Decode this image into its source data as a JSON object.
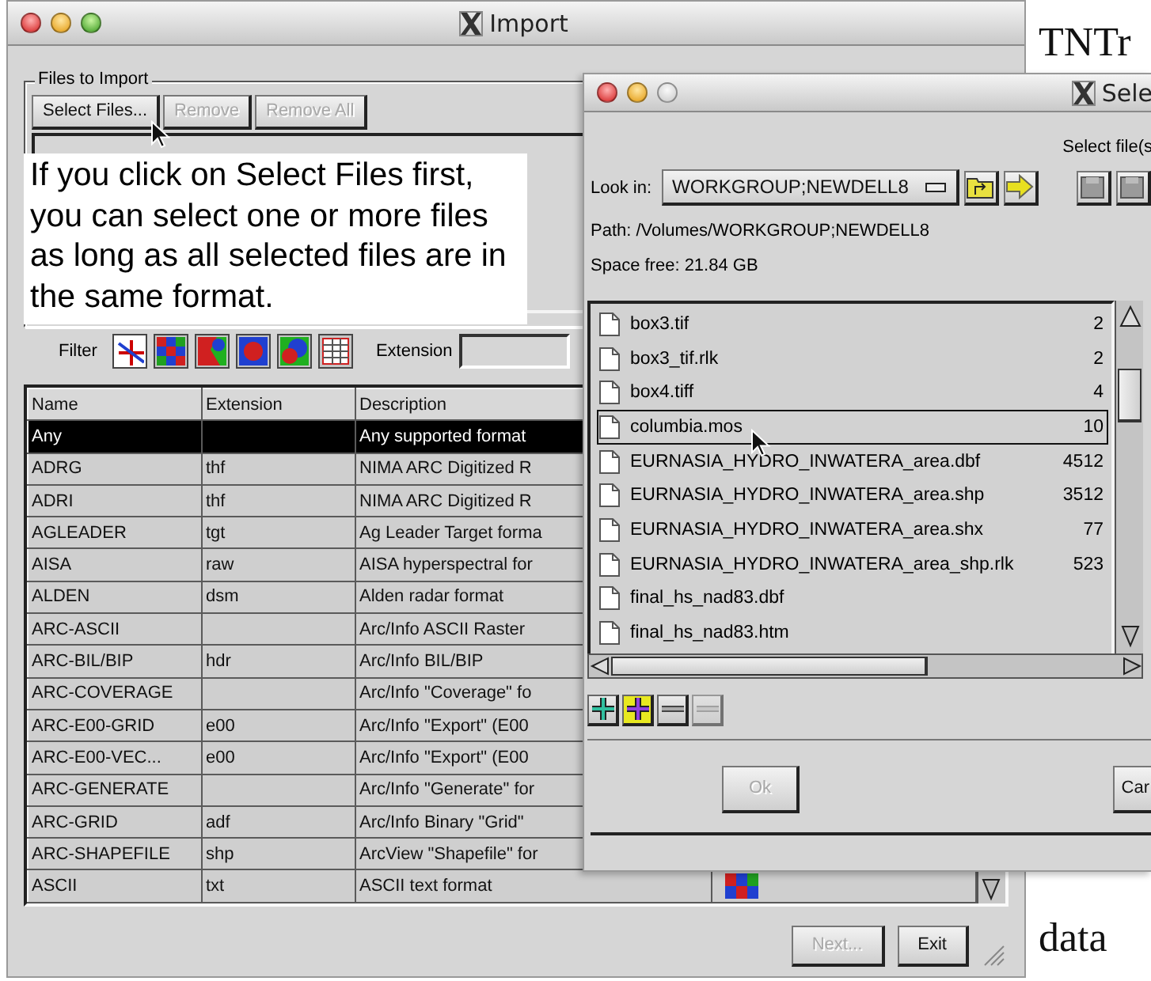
{
  "page_text": {
    "top": "TNTr",
    "bottom": "data"
  },
  "import_window": {
    "title": "Import",
    "group_label": "Files to Import",
    "buttons": [
      {
        "label": "Select Files...",
        "disabled": false
      },
      {
        "label": "Remove",
        "disabled": true
      },
      {
        "label": "Remove All",
        "disabled": true
      }
    ],
    "callout": "If you click on Select Files first, you can select one or more files as long as all selected files are in the same format.",
    "filter_label": "Filter",
    "filters": [
      {
        "kind": "axes",
        "selected": true
      },
      {
        "kind": "checker",
        "selected": false
      },
      {
        "kind": "blobs",
        "selected": false
      },
      {
        "kind": "dot",
        "selected": false
      },
      {
        "kind": "circles",
        "selected": false
      },
      {
        "kind": "table",
        "selected": false
      }
    ],
    "extension_label": "Extension",
    "table": {
      "columns": [
        "Name",
        "Extension",
        "Description"
      ],
      "rows": [
        {
          "name": "Any",
          "description": "Any supported format",
          "selected": true,
          "preview": false
        },
        {
          "name": "ADRG",
          "extension": "thf",
          "description": "NIMA ARC Digitized R",
          "selected": false,
          "preview": false
        },
        {
          "name": "ADRI",
          "extension": "thf",
          "description": "NIMA ARC Digitized R",
          "selected": false,
          "preview": false
        },
        {
          "name": "AGLEADER",
          "extension": "tgt",
          "description": "Ag Leader Target forma",
          "selected": false,
          "preview": false
        },
        {
          "name": "AISA",
          "extension": "raw",
          "description": "AISA hyperspectral for",
          "selected": false,
          "preview": false
        },
        {
          "name": "ALDEN",
          "extension": "dsm",
          "description": "Alden radar format",
          "selected": false,
          "preview": false
        },
        {
          "name": "ARC-ASCII",
          "description": "Arc/Info ASCII Raster",
          "selected": false,
          "preview": false
        },
        {
          "name": "ARC-BIL/BIP",
          "extension": "hdr",
          "description": "Arc/Info BIL/BIP",
          "selected": false,
          "preview": false
        },
        {
          "name": "ARC-COVERAGE",
          "description": "Arc/Info \"Coverage\" fo",
          "selected": false,
          "preview": false
        },
        {
          "name": "ARC-E00-GRID",
          "extension": "e00",
          "description": "Arc/Info \"Export\" (E00",
          "selected": false,
          "preview": false
        },
        {
          "name": "ARC-E00-VEC...",
          "extension": "e00",
          "description": "Arc/Info \"Export\" (E00",
          "selected": false,
          "preview": false
        },
        {
          "name": "ARC-GENERATE",
          "description": "Arc/Info \"Generate\" for",
          "selected": false,
          "preview": false
        },
        {
          "name": "ARC-GRID",
          "extension": "adf",
          "description": "Arc/Info Binary \"Grid\"",
          "selected": false,
          "preview": false
        },
        {
          "name": "ARC-SHAPEFILE",
          "extension": "shp",
          "description": "ArcView \"Shapefile\" for",
          "selected": false,
          "preview": false
        },
        {
          "name": "ASCII",
          "extension": "txt",
          "description": "ASCII text format",
          "selected": false,
          "preview": true
        }
      ]
    },
    "footer_buttons": [
      {
        "label": "Next...",
        "disabled": true
      },
      {
        "label": "Exit",
        "disabled": false
      }
    ]
  },
  "select_window": {
    "title": "Sele",
    "prompt": "Select file(s",
    "look_in_label": "Look in:",
    "look_in_value": "WORKGROUP;NEWDELL8",
    "path": "Path: /Volumes/WORKGROUP;NEWDELL8",
    "space_free": "Space free:  21.84 GB",
    "files": [
      {
        "name": "box3.tif",
        "size": "2",
        "selected": false
      },
      {
        "name": "box3_tif.rlk",
        "size": "2",
        "selected": false
      },
      {
        "name": "box4.tiff",
        "size": "4",
        "selected": false
      },
      {
        "name": "columbia.mos",
        "size": "10",
        "selected": true
      },
      {
        "name": "EURNASIA_HYDRO_INWATERA_area.dbf",
        "size": "4512",
        "selected": false
      },
      {
        "name": "EURNASIA_HYDRO_INWATERA_area.shp",
        "size": "3512",
        "selected": false
      },
      {
        "name": "EURNASIA_HYDRO_INWATERA_area.shx",
        "size": "77",
        "selected": false
      },
      {
        "name": "EURNASIA_HYDRO_INWATERA_area_shp.rlk",
        "size": "523",
        "selected": false
      },
      {
        "name": "final_hs_nad83.dbf",
        "selected": false
      },
      {
        "name": "final_hs_nad83.htm",
        "selected": false
      }
    ],
    "action_buttons": [
      {
        "kind": "add",
        "disabled": false
      },
      {
        "kind": "add-all",
        "disabled": false
      },
      {
        "kind": "remove",
        "disabled": false
      },
      {
        "kind": "remove-all",
        "disabled": true
      }
    ],
    "ok": {
      "label": "Ok",
      "disabled": true
    },
    "cancel": {
      "label": "Car"
    }
  }
}
